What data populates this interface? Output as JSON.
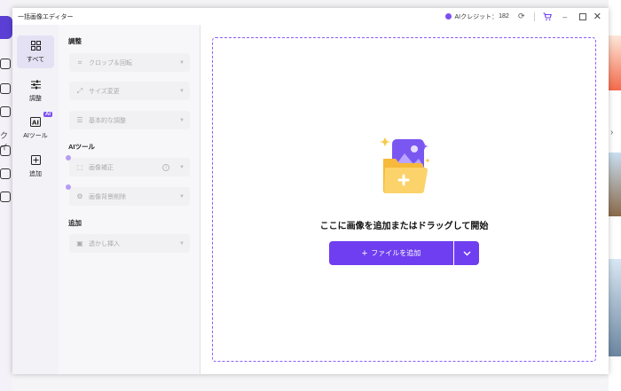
{
  "window": {
    "title": "一括画像エディター",
    "credit_label": "AIクレジット：",
    "credit_count": "182"
  },
  "categories": [
    {
      "label": "すべて",
      "icon": "grid-icon",
      "active": true
    },
    {
      "label": "調整",
      "icon": "sliders-icon"
    },
    {
      "label": "AIツール",
      "icon": "ai-icon",
      "badge": "AI"
    },
    {
      "label": "追加",
      "icon": "plus-box-icon"
    }
  ],
  "sections": {
    "adjust": {
      "title": "調整",
      "items": [
        "クロップ＆回転",
        "サイズ変更",
        "基本的な調整"
      ]
    },
    "ai_tools": {
      "title": "AIツール",
      "items": [
        "画像補正",
        "画像背景削除"
      ]
    },
    "add": {
      "title": "追加",
      "items": [
        "透かし挿入"
      ]
    }
  },
  "drop_area": {
    "text": "ここに画像を追加またはドラッグして開始",
    "add_button": "ファイルを追加"
  },
  "background": {
    "rail_text": "クイ"
  },
  "colors": {
    "accent": "#6f3ef0",
    "dashed_border": "#8b5cf6",
    "folder": "#f6b93b"
  }
}
